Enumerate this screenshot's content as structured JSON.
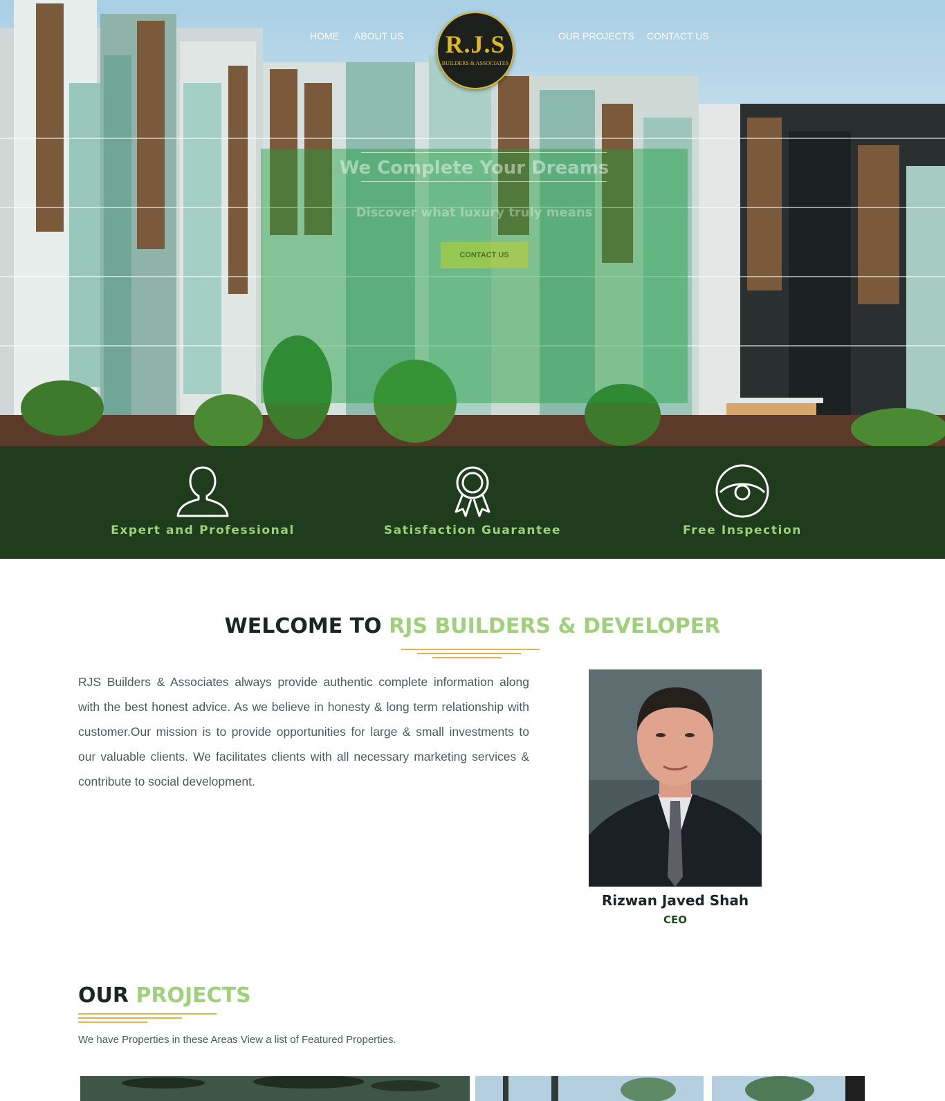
{
  "nav": {
    "items": [
      "HOME",
      "ABOUT US",
      "OUR PROJECTS",
      "CONTACT US"
    ]
  },
  "logo": {
    "main": "R.J.S",
    "tagline": "BUILDERS & ASSOCIATES"
  },
  "hero": {
    "title": "We Complete Your Dreams",
    "subtitle": "Discover what luxury truly means",
    "cta": "CONTACT US"
  },
  "features": [
    {
      "label": "Expert and Professional",
      "icon": "user-icon"
    },
    {
      "label": "Satisfaction Guarantee",
      "icon": "award-ribbon-icon"
    },
    {
      "label": "Free Inspection",
      "icon": "eye-icon"
    }
  ],
  "welcome": {
    "title_prefix": "WELCOME TO",
    "title_accent": "RJS BUILDERS & DEVELOPER",
    "body": "RJS Builders & Associates always provide authentic complete information along with the best honest advice. As we believe in honesty & long term relationship with customer.Our mission is to provide opportunities for large & small investments to our valuable clients. We facilitates clients with all necessary marketing services & contribute to social development."
  },
  "ceo": {
    "name": "Rizwan Javed Shah",
    "role": "CEO"
  },
  "projects": {
    "title_prefix": "OUR",
    "title_accent": "PROJECTS",
    "subtitle": "We have Properties in these Areas View a list of Featured Properties."
  },
  "colors": {
    "accent_green": "#9fd07a",
    "dark_green": "#1f3d1d",
    "gold": "#e6b34a"
  }
}
